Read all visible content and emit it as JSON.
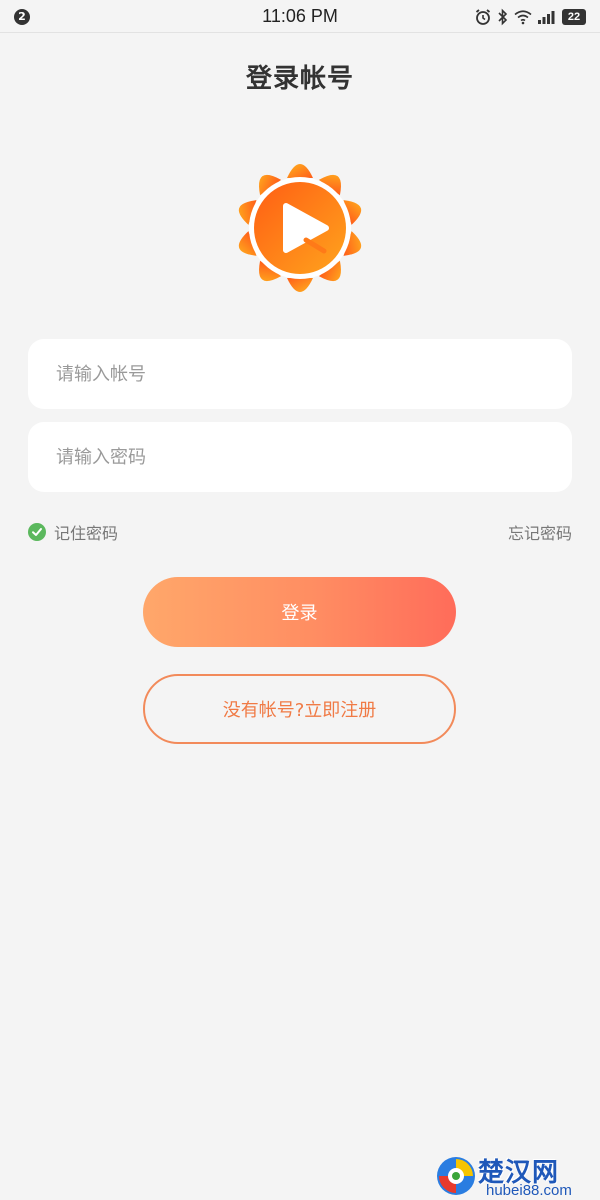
{
  "status_bar": {
    "notification_count": "2",
    "time": "11:06 PM",
    "battery": "22",
    "icons": [
      "alarm-icon",
      "bluetooth-icon",
      "wifi-icon",
      "signal-icon",
      "battery-icon"
    ]
  },
  "header": {
    "title": "登录帐号"
  },
  "logo": {
    "icon": "sunflower-play-logo",
    "colors": [
      "#ff9a1f",
      "#ff5a1a"
    ]
  },
  "form": {
    "account_placeholder": "请输入帐号",
    "password_placeholder": "请输入密码",
    "remember_label": "记住密码",
    "remember_checked": true,
    "forgot_label": "忘记密码"
  },
  "actions": {
    "login_label": "登录",
    "register_label": "没有帐号?立即注册"
  },
  "watermark": {
    "text": "楚汉网",
    "url": "hubei88.com"
  },
  "colors": {
    "accent": "#ff8d62",
    "accent_outline": "#f28a5a",
    "check": "#5bb85d",
    "background": "#f4f4f4"
  }
}
